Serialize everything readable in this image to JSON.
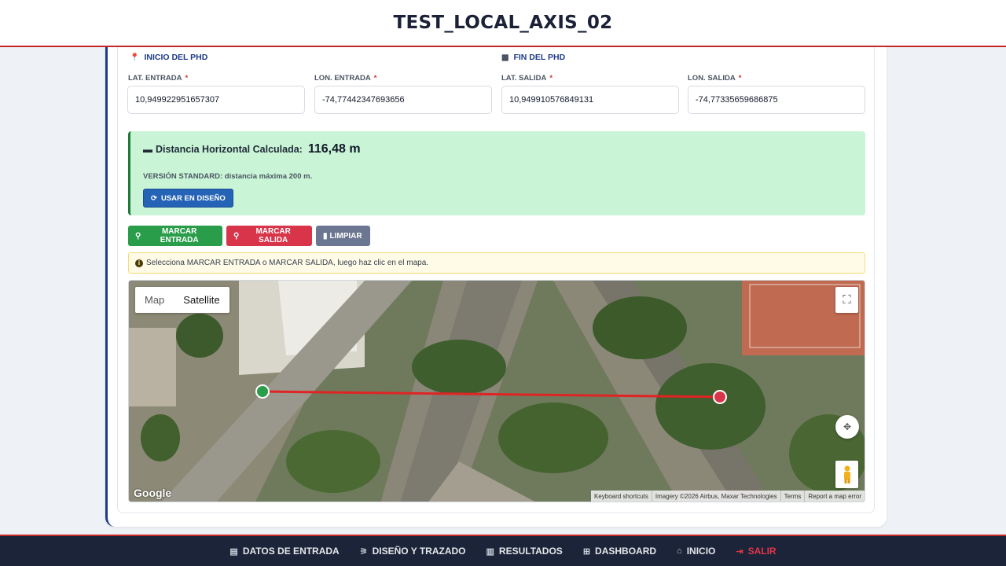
{
  "header": {
    "title": "TEST_LOCAL_AXIS_02"
  },
  "sections": {
    "start": {
      "title": "INICIO DEL PHD",
      "icon": "map-pin-icon"
    },
    "end": {
      "title": "FIN DEL PHD",
      "icon": "checkered-flag-icon"
    }
  },
  "fields": {
    "lat_in": {
      "label": "LAT. ENTRADA",
      "value": "10,949922951657307"
    },
    "lon_in": {
      "label": "LON. ENTRADA",
      "value": "-74,77442347693656"
    },
    "lat_out": {
      "label": "LAT. SALIDA",
      "value": "10,949910576849131"
    },
    "lon_out": {
      "label": "LON. SALIDA",
      "value": "-74,77335659686875"
    },
    "required_mark": "*"
  },
  "result": {
    "label": "Distancia Horizontal Calculada:",
    "value": "116,48 m",
    "note": "VERSIÓN STANDARD: distancia máxima 200 m.",
    "use_button": "USAR EN DISEÑO"
  },
  "actions": {
    "mark_entry": "MARCAR ENTRADA",
    "mark_exit": "MARCAR SALIDA",
    "clear": "LIMPIAR"
  },
  "hint": "Selecciona MARCAR ENTRADA o MARCAR SALIDA, luego haz clic en el mapa.",
  "map": {
    "type_options": [
      "Map",
      "Satellite"
    ],
    "selected_type": "Satellite",
    "logo": "Google",
    "attribution": [
      "Keyboard shortcuts",
      "Imagery ©2026 Airbus, Maxar Technologies",
      "Terms",
      "Report a map error"
    ],
    "colors": {
      "entry_marker": "#2a9d4a",
      "exit_marker": "#d8344a",
      "route_line": "#e02424"
    }
  },
  "nav": {
    "items": [
      {
        "label": "DATOS DE ENTRADA",
        "icon": "clipboard-icon"
      },
      {
        "label": "DISEÑO Y TRAZADO",
        "icon": "compass-icon"
      },
      {
        "label": "RESULTADOS",
        "icon": "bar-chart-icon"
      },
      {
        "label": "DASHBOARD",
        "icon": "grid-icon"
      },
      {
        "label": "INICIO",
        "icon": "home-icon"
      },
      {
        "label": "SALIR",
        "icon": "logout-icon"
      }
    ]
  },
  "colors": {
    "brand_navy": "#1b2438",
    "accent_red": "#c62828",
    "success_bg": "#c9f5d6"
  }
}
